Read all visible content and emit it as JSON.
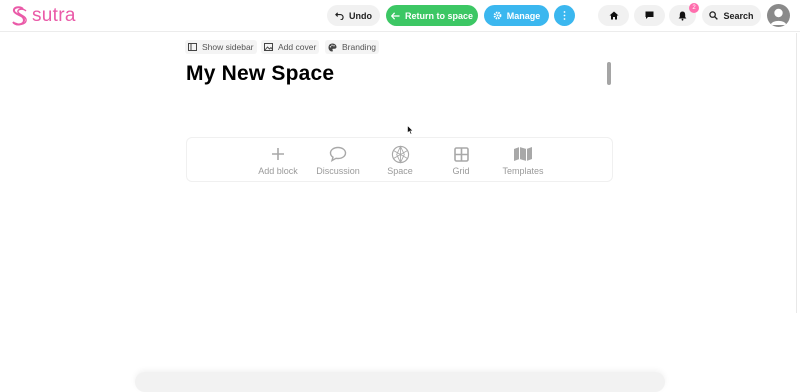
{
  "app": {
    "logo_text": "sutra",
    "brand_color": "#ea5aa8"
  },
  "header": {
    "undo_label": "Undo",
    "return_label": "Return to space",
    "manage_label": "Manage",
    "search_label": "Search",
    "notification_count": "2",
    "colors": {
      "return": "#3cc764",
      "manage": "#3bb7ef"
    }
  },
  "page_tools": {
    "show_sidebar": "Show sidebar",
    "add_cover": "Add cover",
    "branding": "Branding"
  },
  "page": {
    "title": "My New Space"
  },
  "blocks": [
    {
      "label": "Add block",
      "icon": "plus-icon"
    },
    {
      "label": "Discussion",
      "icon": "speech-bubble-icon"
    },
    {
      "label": "Space",
      "icon": "space-icon"
    },
    {
      "label": "Grid",
      "icon": "grid-icon"
    },
    {
      "label": "Templates",
      "icon": "map-icon"
    }
  ]
}
